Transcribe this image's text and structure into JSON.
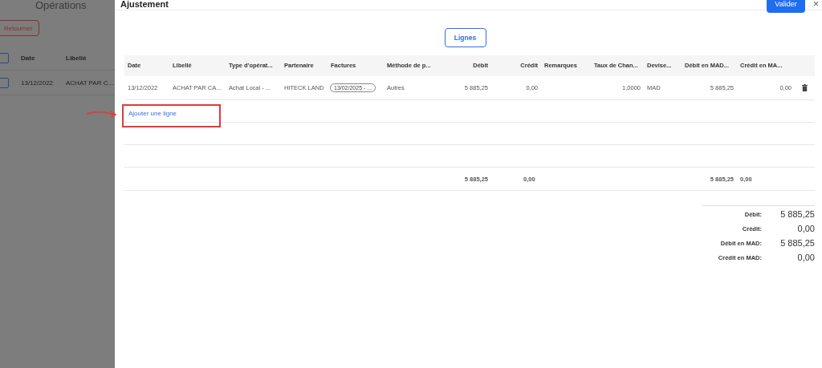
{
  "background_page": {
    "title": "Opérations",
    "back_button": "Retourner",
    "columns": [
      "Date",
      "Libellé"
    ],
    "rows": [
      {
        "date": "13/12/2022",
        "label": "ACHAT PAR C...",
        "checked": false
      }
    ],
    "header_checked": false
  },
  "modal": {
    "title": "Ajustement",
    "validate_button": "Valider",
    "close": "×",
    "lines_button": "Lignes",
    "columns": [
      "Date",
      "Libellé",
      "Type d'opérat...",
      "Partenaire",
      "Factures",
      "Méthode de p...",
      "Débit",
      "Crédit",
      "Remarques",
      "Taux de Chan...",
      "Devise...",
      "Débit en MAD...",
      "Crédit en MA..."
    ],
    "rows": [
      {
        "date": "13/12/2022",
        "label": "ACHAT PAR CA...",
        "type": "Achat Local - ...",
        "partner": "HITECK LAND",
        "invoice": "13/02/2025 - ...",
        "method": "Autres",
        "debit": "5 885,25",
        "credit": "0,00",
        "rate": "1,0000",
        "currency": "MAD",
        "debit_mad": "5 885,25",
        "credit_mad": "0,00"
      }
    ],
    "add_line": "Ajouter une ligne",
    "totals": {
      "debit": "5 885,25",
      "credit": "0,00",
      "debit_mad": "5 885,25",
      "credit_mad": "0,00"
    },
    "summary": [
      {
        "label": "Débit:",
        "value": "5 885,25"
      },
      {
        "label": "Crédit:",
        "value": "0,00"
      },
      {
        "label": "Débit en MAD:",
        "value": "5 885,25"
      },
      {
        "label": "Crédit en MAD:",
        "value": "0,00"
      }
    ]
  }
}
